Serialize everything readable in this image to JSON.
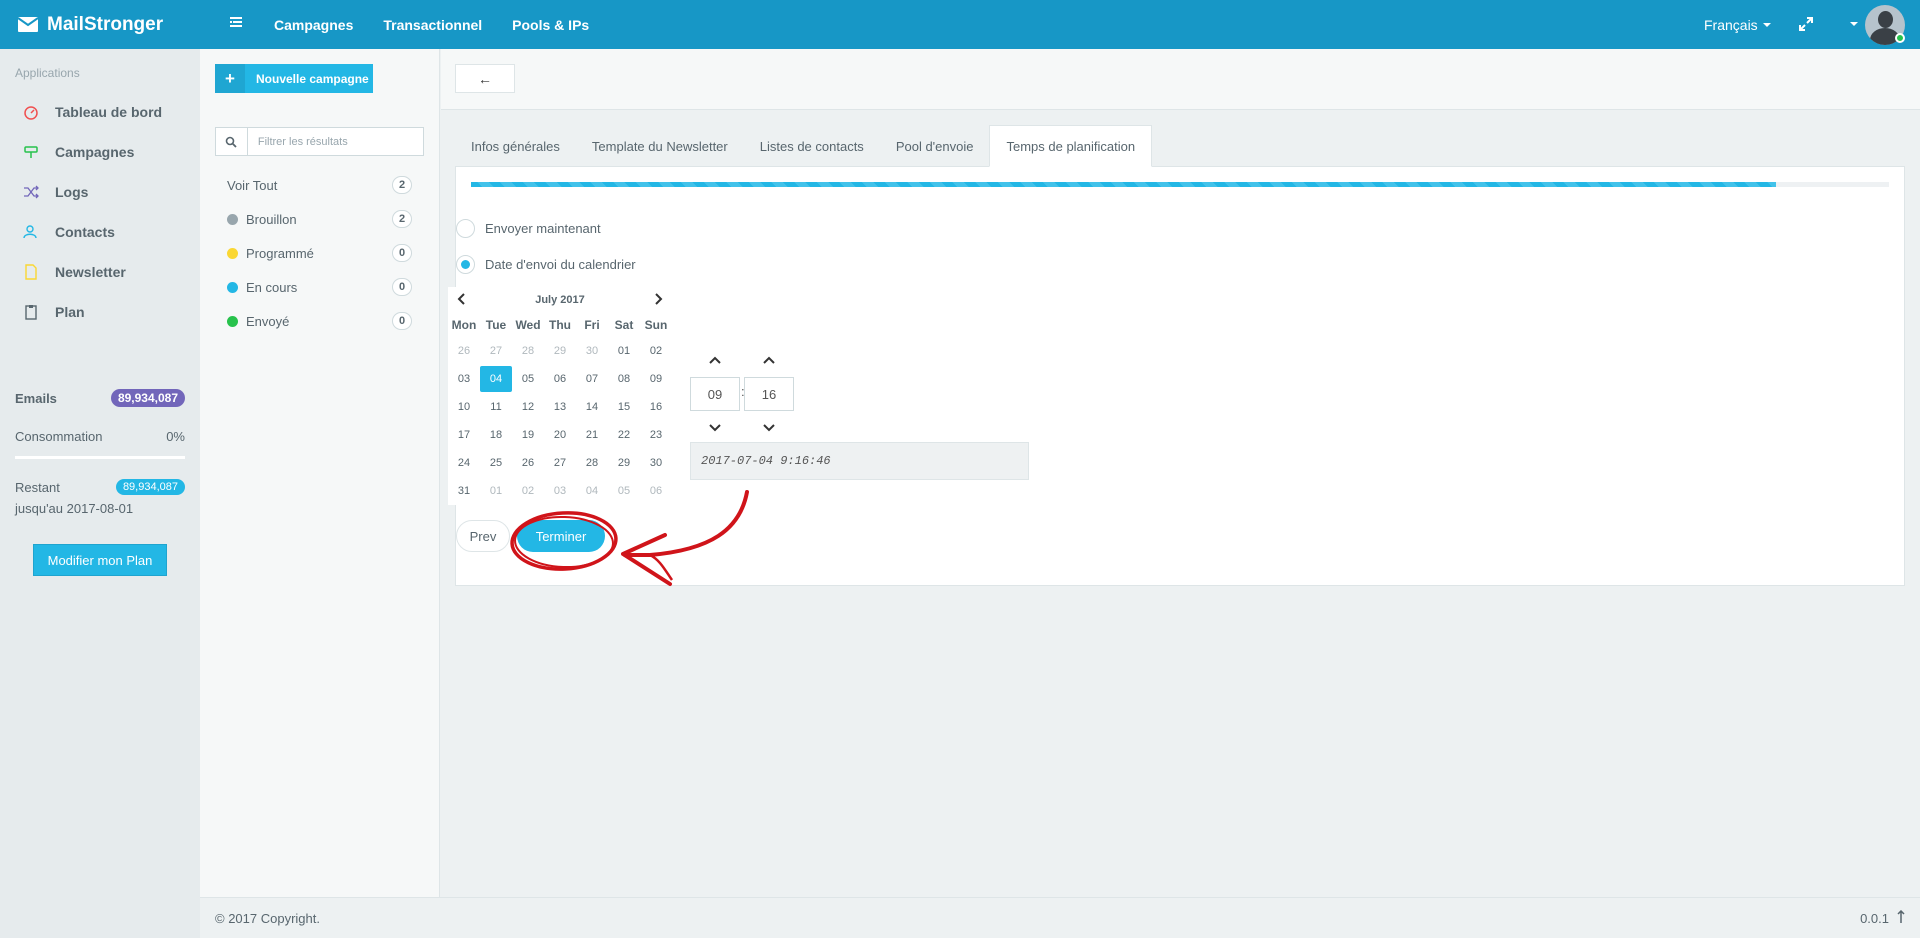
{
  "topbar": {
    "brand": "MailStronger",
    "nav": [
      "Campagnes",
      "Transactionnel",
      "Pools & IPs"
    ],
    "language": "Français"
  },
  "sidebar": {
    "heading": "Applications",
    "items": [
      {
        "label": "Tableau de bord",
        "icon": "dashboard-icon",
        "color": "#f05050"
      },
      {
        "label": "Campagnes",
        "icon": "campaign-icon",
        "color": "#27c24c"
      },
      {
        "label": "Logs",
        "icon": "shuffle-icon",
        "color": "#7266ba"
      },
      {
        "label": "Contacts",
        "icon": "contacts-icon",
        "color": "#23b7e5"
      },
      {
        "label": "Newsletter",
        "icon": "file-icon",
        "color": "#fad733"
      },
      {
        "label": "Plan",
        "icon": "clipboard-icon",
        "color": "#58666e"
      }
    ],
    "emails_label": "Emails",
    "emails_value": "89,934,087",
    "consumption_label": "Consommation",
    "consumption_value": "0%",
    "remaining_label": "Restant",
    "remaining_value": "89,934,087",
    "until": "jusqu'au 2017-08-01",
    "plan_button": "Modifier mon Plan"
  },
  "campaigns": {
    "new_button": "Nouvelle campagne",
    "filter_placeholder": "Filtrer les résultats",
    "filters": [
      {
        "label": "Voir Tout",
        "count": "2",
        "color": ""
      },
      {
        "label": "Brouillon",
        "count": "2",
        "color": "#98a6ad"
      },
      {
        "label": "Programmé",
        "count": "0",
        "color": "#fad733"
      },
      {
        "label": "En cours",
        "count": "0",
        "color": "#23b7e5"
      },
      {
        "label": "Envoyé",
        "count": "0",
        "color": "#27c24c"
      }
    ]
  },
  "main": {
    "back_label": "←",
    "tabs": [
      "Infos générales",
      "Template du Newsletter",
      "Listes de contacts",
      "Pool d'envoie",
      "Temps de planification"
    ],
    "active_tab": 4,
    "progress_percent": 92,
    "radio_now": "Envoyer maintenant",
    "radio_calendar": "Date d'envoi du calendrier",
    "calendar": {
      "month_label": "July 2017",
      "weekdays": [
        "Mon",
        "Tue",
        "Wed",
        "Thu",
        "Fri",
        "Sat",
        "Sun"
      ],
      "weeks": [
        [
          "26",
          "27",
          "28",
          "29",
          "30",
          "01",
          "02"
        ],
        [
          "03",
          "04",
          "05",
          "06",
          "07",
          "08",
          "09"
        ],
        [
          "10",
          "11",
          "12",
          "13",
          "14",
          "15",
          "16"
        ],
        [
          "17",
          "18",
          "19",
          "20",
          "21",
          "22",
          "23"
        ],
        [
          "24",
          "25",
          "26",
          "27",
          "28",
          "29",
          "30"
        ],
        [
          "31",
          "01",
          "02",
          "03",
          "04",
          "05",
          "06"
        ]
      ],
      "selected": "04"
    },
    "time": {
      "hour": "09",
      "minute": "16",
      "separator": ":"
    },
    "datetime_value": "2017-07-04 9:16:46",
    "prev_button": "Prev",
    "finish_button": "Terminer"
  },
  "footer": {
    "copyright": "© 2017 Copyright.",
    "version": "0.0.1"
  },
  "colors": {
    "topbar": "#1797c6",
    "accent": "#23b7e5",
    "annotation": "#d0141a"
  }
}
